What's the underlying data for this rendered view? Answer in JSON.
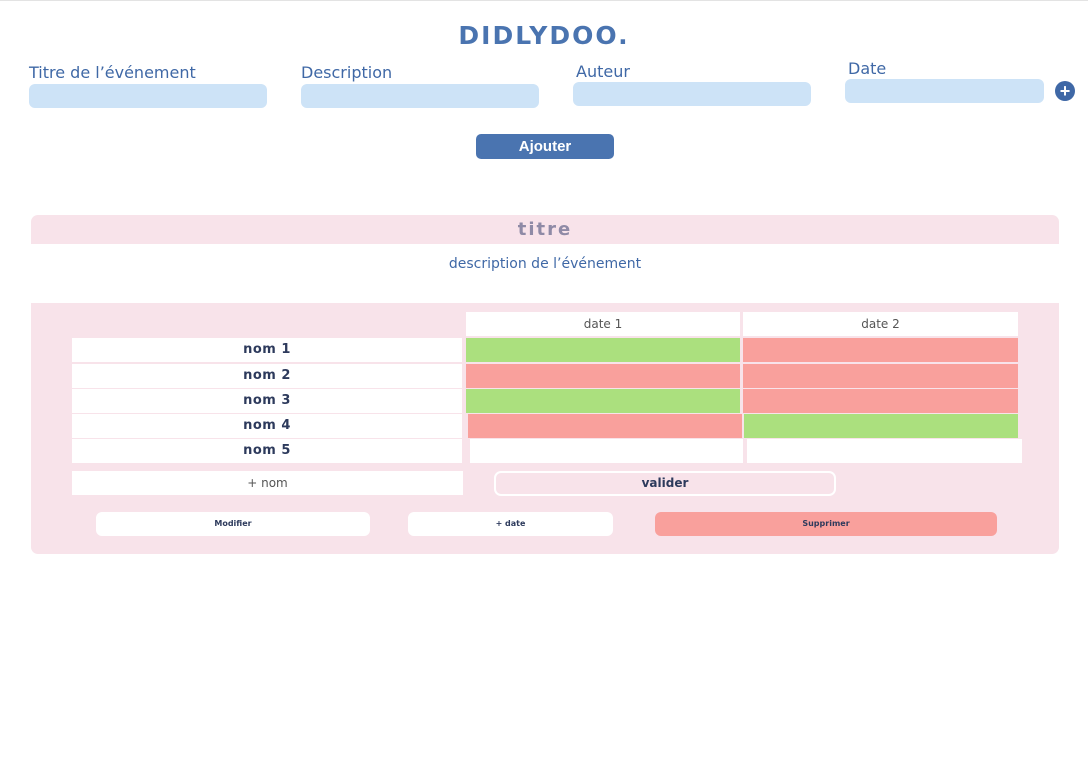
{
  "logo": "DIDLYDOO.",
  "form": {
    "title_label": "Titre de l’événement",
    "description_label": "Description",
    "author_label": "Auteur",
    "date_label": "Date",
    "add_date_icon": "plus-circle-icon",
    "submit_label": "Ajouter"
  },
  "event": {
    "title": "titre",
    "description": "description de l’événement",
    "dates": [
      "date 1",
      "date 2"
    ],
    "participants": [
      {
        "name": "nom 1",
        "votes": [
          "yes",
          "no"
        ]
      },
      {
        "name": "nom 2",
        "votes": [
          "no",
          "no"
        ]
      },
      {
        "name": "nom 3",
        "votes": [
          "yes",
          "no"
        ]
      },
      {
        "name": "nom 4",
        "votes": [
          "no",
          "yes"
        ]
      },
      {
        "name": "nom 5",
        "votes": [
          "empty",
          "empty"
        ]
      }
    ],
    "add_name_label": "+ nom",
    "validate_label": "valider",
    "modify_label": "Modifier",
    "add_date_label": "+ date",
    "delete_label": "Supprimer"
  },
  "colors": {
    "brand": "#4a74b0",
    "input_bg": "#cde3f7",
    "card_bg": "#f8e3ea",
    "vote_yes": "#abe07e",
    "vote_no": "#f9a09c"
  }
}
